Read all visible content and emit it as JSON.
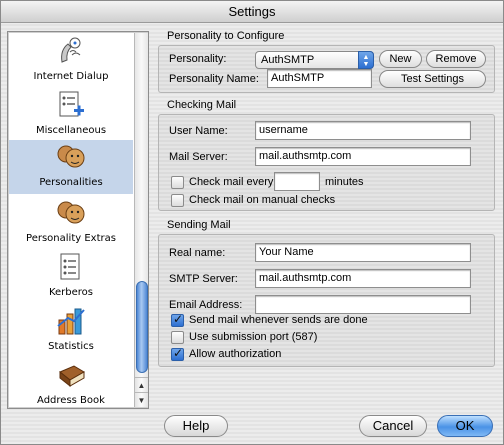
{
  "window": {
    "title": "Settings"
  },
  "sidebar": {
    "items": [
      {
        "label": "Internet Dialup",
        "icon": "phone-dial-icon",
        "selected": false
      },
      {
        "label": "Miscellaneous",
        "icon": "document-plus-icon",
        "selected": false
      },
      {
        "label": "Personalities",
        "icon": "faces-icon",
        "selected": true
      },
      {
        "label": "Personality Extras",
        "icon": "faces-icon",
        "selected": false
      },
      {
        "label": "Kerberos",
        "icon": "document-list-icon",
        "selected": false
      },
      {
        "label": "Statistics",
        "icon": "bar-chart-icon",
        "selected": false
      },
      {
        "label": "Address Book",
        "icon": "book-icon",
        "selected": false
      }
    ]
  },
  "personality_group": {
    "title": "Personality to Configure",
    "personality_label": "Personality:",
    "personality_value": "AuthSMTP",
    "new_label": "New",
    "remove_label": "Remove",
    "name_label": "Personality Name:",
    "name_value": "AuthSMTP",
    "test_label": "Test Settings"
  },
  "checking_group": {
    "title": "Checking Mail",
    "user_label": "User Name:",
    "user_value": "username",
    "server_label": "Mail Server:",
    "server_value": "mail.authsmtp.com",
    "check_every_label": "Check mail every",
    "check_every_value": "",
    "minutes_label": "minutes",
    "check_every_checked": false,
    "manual_label": "Check mail on manual checks",
    "manual_checked": false
  },
  "sending_group": {
    "title": "Sending Mail",
    "real_name_label": "Real name:",
    "real_name_value": "Your Name",
    "smtp_label": "SMTP Server:",
    "smtp_value": "mail.authsmtp.com",
    "email_label": "Email Address:",
    "email_value": "",
    "send_when_done_label": "Send mail whenever sends are done",
    "send_when_done_checked": true,
    "submission_port_label": "Use submission port (587)",
    "submission_port_checked": false,
    "allow_auth_label": "Allow authorization",
    "allow_auth_checked": true
  },
  "buttons": {
    "help": "Help",
    "cancel": "Cancel",
    "ok": "OK"
  },
  "colors": {
    "selection": "#c5d5ea",
    "accent": "#2d6fd1"
  }
}
